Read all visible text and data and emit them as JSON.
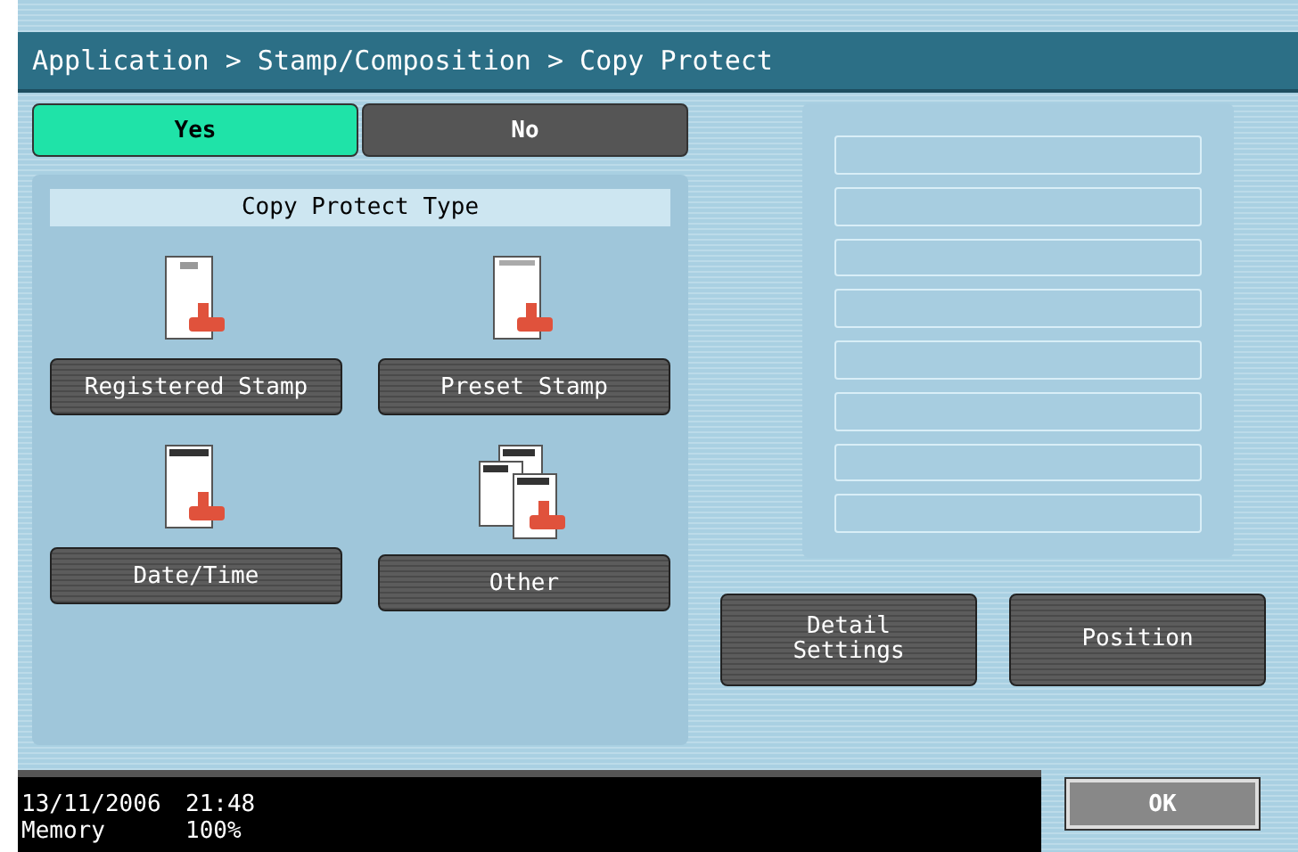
{
  "breadcrumb": "Application > Stamp/Composition > Copy Protect",
  "toggle": [
    {
      "label": "Yes",
      "selected": true
    },
    {
      "label": "No",
      "selected": false
    }
  ],
  "type_panel": {
    "title": "Copy Protect Type",
    "options": [
      {
        "kind": "registered",
        "label": "Registered Stamp"
      },
      {
        "kind": "preset",
        "label": "Preset Stamp"
      },
      {
        "kind": "datetime",
        "label": "Date/Time"
      },
      {
        "kind": "other",
        "label": "Other"
      }
    ]
  },
  "actions": [
    {
      "label": "Detail\nSettings"
    },
    {
      "label": "Position"
    }
  ],
  "status_bar": {
    "date": "13/11/2006",
    "time": "21:48",
    "memory_label": "Memory",
    "memory_value": "100%"
  },
  "ok_button": "OK"
}
